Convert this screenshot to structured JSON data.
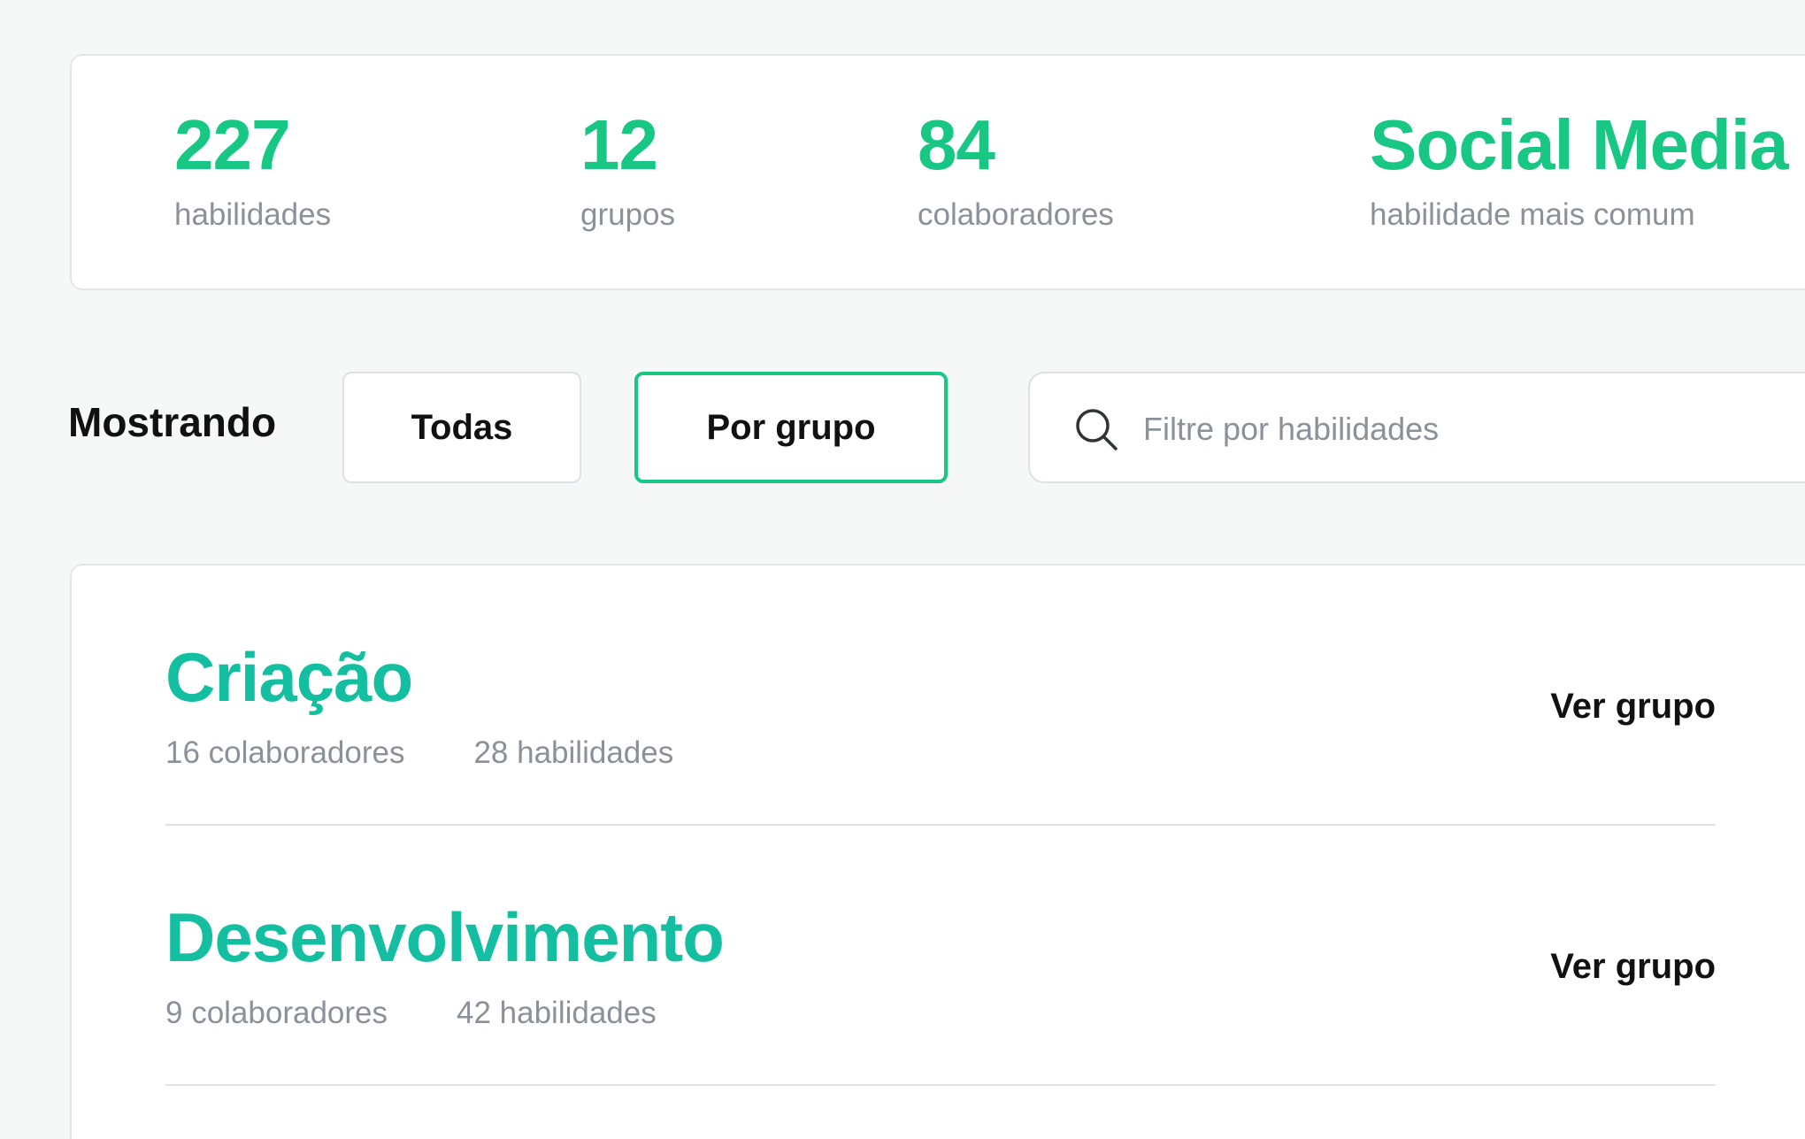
{
  "stats": [
    {
      "value": "227",
      "label": "habilidades"
    },
    {
      "value": "12",
      "label": "grupos"
    },
    {
      "value": "84",
      "label": "colaboradores"
    },
    {
      "value": "Social Media",
      "label": "habilidade mais comum"
    }
  ],
  "filter": {
    "showing_label": "Mostrando",
    "options": [
      {
        "label": "Todas",
        "selected": false
      },
      {
        "label": "Por grupo",
        "selected": true
      }
    ],
    "search": {
      "placeholder": "Filtre por habilidades",
      "icon": "search-icon"
    }
  },
  "groups": [
    {
      "name": "Criação",
      "collaborators": "16 colaboradores",
      "skills": "28 habilidades",
      "action": "Ver grupo"
    },
    {
      "name": "Desenvolvimento",
      "collaborators": "9 colaboradores",
      "skills": "42 habilidades",
      "action": "Ver grupo"
    }
  ],
  "colors": {
    "accent": "#19c784",
    "group_title": "#13bfa0",
    "muted_text": "#8a9199",
    "background": "#f6f7f7"
  }
}
